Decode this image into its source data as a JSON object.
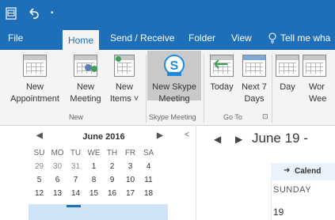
{
  "tabs": [
    "File",
    "Home",
    "Send / Receive",
    "Folder",
    "View"
  ],
  "active_tab": "Home",
  "tell_me": "Tell me wha",
  "ribbon": {
    "new_appointment": [
      "New",
      "Appointment"
    ],
    "new_meeting": [
      "New",
      "Meeting"
    ],
    "new_items": [
      "New",
      "Items ˅"
    ],
    "group_new": "New",
    "new_skype_meeting": [
      "New Skype",
      "Meeting"
    ],
    "group_skype": "Skype Meeting",
    "today": "Today",
    "next7": [
      "Next 7",
      "Days"
    ],
    "group_goto": "Go To",
    "day": "Day",
    "work_week": [
      "Wor",
      "Wee"
    ]
  },
  "mini_calendar": {
    "title": "June 2016",
    "prev": "◀",
    "next": "▶",
    "dow": [
      "SU",
      "MO",
      "TU",
      "WE",
      "TH",
      "FR",
      "SA"
    ],
    "weeks": [
      [
        "29",
        "30",
        "31",
        "1",
        "2",
        "3",
        "4"
      ],
      [
        "5",
        "6",
        "7",
        "8",
        "9",
        "10",
        "11"
      ],
      [
        "12",
        "13",
        "14",
        "15",
        "16",
        "17",
        "18"
      ]
    ],
    "today": "15"
  },
  "calendar_view": {
    "date_range": "June 19 -",
    "header": "Calend",
    "day_name": "SUNDAY",
    "day_number": "19"
  },
  "colors": {
    "accent": "#1e6fb8",
    "ribbon_bg": "#f4f4f4"
  }
}
